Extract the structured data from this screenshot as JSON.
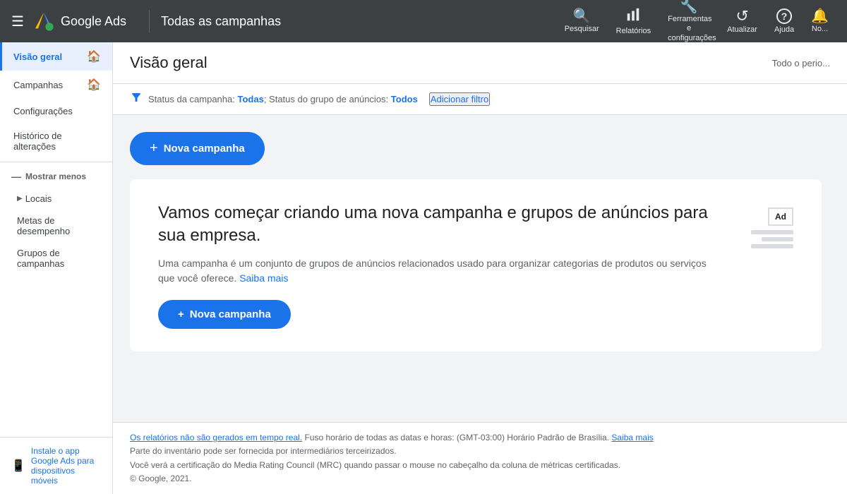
{
  "topNav": {
    "hamburgerIcon": "☰",
    "appName": "Google Ads",
    "pageTitle": "Todas as campanhas",
    "actions": [
      {
        "id": "search",
        "icon": "🔍",
        "label": "Pesquisar"
      },
      {
        "id": "reports",
        "icon": "📊",
        "label": "Relatórios"
      },
      {
        "id": "tools",
        "icon": "🔧",
        "label": "Ferramentas e configurações"
      },
      {
        "id": "refresh",
        "icon": "↺",
        "label": "Atualizar"
      },
      {
        "id": "help",
        "icon": "?",
        "label": "Ajuda"
      },
      {
        "id": "notifications",
        "icon": "🔔",
        "label": "No..."
      }
    ]
  },
  "sidebar": {
    "items": [
      {
        "id": "visao-geral",
        "label": "Visão geral",
        "active": true,
        "hasIcon": true
      },
      {
        "id": "campanhas",
        "label": "Campanhas",
        "active": false,
        "hasIcon": true
      },
      {
        "id": "configuracoes",
        "label": "Configurações",
        "active": false,
        "hasIcon": false
      },
      {
        "id": "historico",
        "label": "Histórico de alterações",
        "active": false,
        "hasIcon": false
      }
    ],
    "sectionHeader": "Mostrar menos",
    "childItems": [
      {
        "id": "locais",
        "label": "Locais",
        "hasChevron": true
      },
      {
        "id": "metas",
        "label": "Metas de desempenho",
        "hasChevron": false
      },
      {
        "id": "grupos",
        "label": "Grupos de campanhas",
        "hasChevron": false
      }
    ],
    "footer": {
      "line1": "Instale o app",
      "line2": "Google Ads para",
      "line3": "dispositivos móveis"
    }
  },
  "contentHeader": {
    "title": "Visão geral",
    "periodLabel": "Todo o perio..."
  },
  "filterBar": {
    "filterText": "Status da campanha: ",
    "filterValue1": "Todas",
    "filterSep": "; Status do grupo de anúncios: ",
    "filterValue2": "Todos",
    "addFilterLabel": "Adicionar filtro"
  },
  "newCampaignBtn1": {
    "plus": "+",
    "label": "Nova campanha"
  },
  "promoCard": {
    "headline": "Vamos começar criando uma nova campanha e grupos de anúncios para sua empresa.",
    "description": "Uma campanha é um conjunto de grupos de anúncios relacionados usado para organizar categorias de produtos ou serviços que você oferece.",
    "learnMoreLabel": "Saiba mais",
    "newCampaignBtn": {
      "plus": "+",
      "label": "Nova campanha"
    },
    "adIllustration": {
      "adLabel": "Ad"
    }
  },
  "footer": {
    "reportNote": "Os relatórios não são gerados em tempo real.",
    "timezone": "Fuso horário de todas as datas e horas: (GMT-03:00) Horário Padrão de Brasília.",
    "learnMoreLabel": "Saiba mais",
    "inventoryNote": "Parte do inventário pode ser fornecida por intermediários terceirizados.",
    "mrcNote": "Você verá a certificação do Media Rating Council (MRC) quando passar o mouse no cabeçalho da coluna de métricas certificadas.",
    "copyright": "© Google, 2021."
  }
}
